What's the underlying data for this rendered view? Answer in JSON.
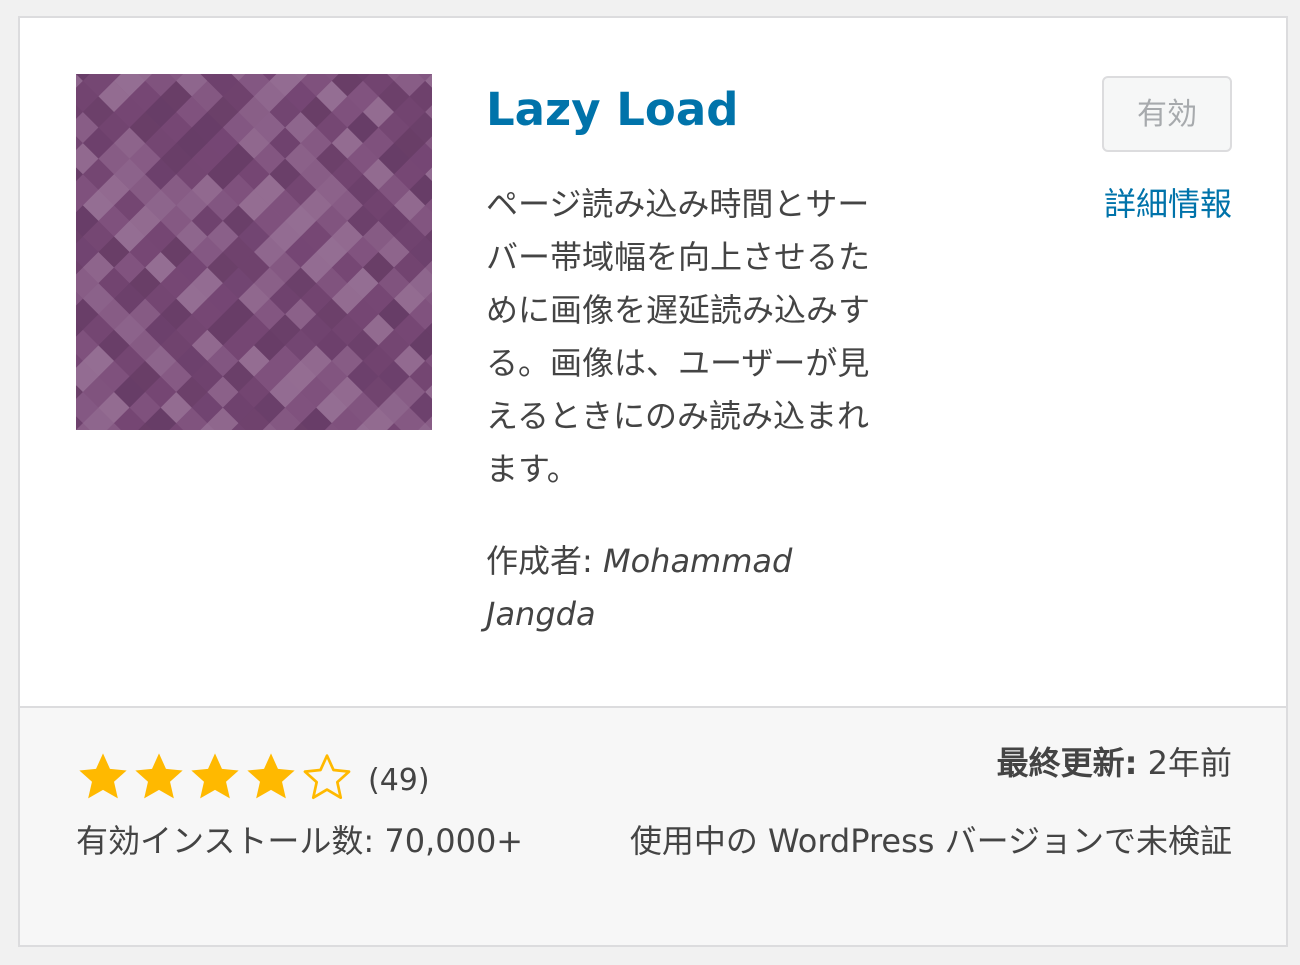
{
  "plugin": {
    "name": "Lazy Load",
    "description": "ページ読み込み時間とサーバー帯域幅を向上させるために画像を遅延読み込みする。画像は、ユーザーが見えるときにのみ読み込まれます。",
    "author_label": "作成者:",
    "author_name": "Mohammad Jangda",
    "thumbnail_icon": "purple-diamond-pattern"
  },
  "actions": {
    "activate_label": "有効",
    "details_label": "詳細情報"
  },
  "footer": {
    "rating_stars": 4,
    "rating_max": 5,
    "rating_count": "(49)",
    "installs_label": "有効インストール数:",
    "installs_value": "70,000+",
    "last_updated_label": "最終更新:",
    "last_updated_value": "2年前",
    "compat_text": "使用中の WordPress バージョンで未検証"
  },
  "colors": {
    "link": "#0073aa",
    "star": "#ffb900",
    "thumbnail_base": "#7a4a78"
  }
}
